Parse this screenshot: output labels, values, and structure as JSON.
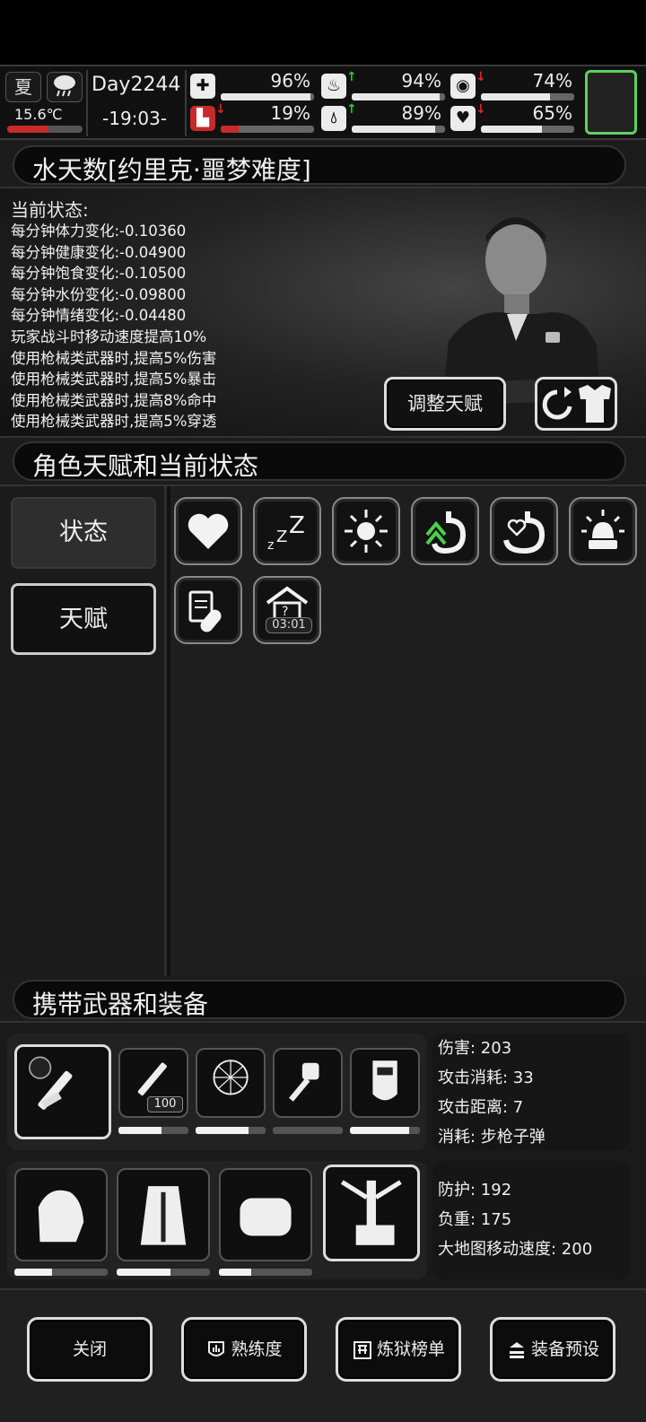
{
  "status_bar": {
    "season": "夏",
    "temperature": "15.6℃",
    "day": "Day2244",
    "time": "-19:03-",
    "stats": [
      {
        "name": "medical",
        "icon": "medkit-icon",
        "value": "96%",
        "fill": 0.96,
        "trend": ""
      },
      {
        "name": "stomach",
        "icon": "stomach-icon",
        "value": "94%",
        "fill": 0.94,
        "trend": "up"
      },
      {
        "name": "sanity",
        "icon": "brain-icon",
        "value": "74%",
        "fill": 0.74,
        "trend": "down"
      },
      {
        "name": "stamina",
        "icon": "boot-icon",
        "value": "19%",
        "fill": 0.19,
        "trend": "down"
      },
      {
        "name": "water",
        "icon": "water-drop-icon",
        "value": "89%",
        "fill": 0.89,
        "trend": "up"
      },
      {
        "name": "mood",
        "icon": "heart-icon",
        "value": "65%",
        "fill": 0.65,
        "trend": "down"
      }
    ]
  },
  "character_header": "水天数[约里克·噩梦难度]",
  "character": {
    "status_title": "当前状态:",
    "status_lines": [
      "每分钟体力变化:-0.10360",
      "每分钟健康变化:-0.04900",
      "每分钟饱食变化:-0.10500",
      "每分钟水份变化:-0.09800",
      "每分钟情绪变化:-0.04480",
      "玩家战斗时移动速度提高10%",
      "使用枪械类武器时,提高5%伤害",
      "使用枪械类武器时,提高5%暴击",
      "使用枪械类武器时,提高8%命中",
      "使用枪械类武器时,提高5%穿透"
    ],
    "adjust_talent_button": "调整天赋"
  },
  "talent_header": "角色天赋和当前状态",
  "tabs": {
    "status": "状态",
    "talent": "天赋"
  },
  "status_icons": [
    "heart-icon",
    "sleep-icon",
    "sun-icon",
    "stomach-up-icon",
    "stomach-love-icon",
    "alarm-icon",
    "medicine-icon",
    "shelter-icon"
  ],
  "shelter_timer": "03:01",
  "equipment_header": "携带武器和装备",
  "weapons": {
    "ammo_count": "100",
    "durability": [
      0.62,
      0.75,
      0.0,
      0.85
    ],
    "stats": {
      "damage": "伤害: 203",
      "attack_cost": "攻击消耗: 33",
      "attack_range": "攻击距离: 7",
      "consume": "消耗: 步枪子弹"
    }
  },
  "armor": {
    "durability": [
      0.4,
      0.58,
      0.35
    ],
    "stats": {
      "defense": "防护: 192",
      "weight": "负重: 175",
      "map_speed": "大地图移动速度: 200"
    }
  },
  "bottom_buttons": {
    "close": "关闭",
    "proficiency": "熟练度",
    "leaderboard": "炼狱榜单",
    "preset": "装备预设"
  }
}
